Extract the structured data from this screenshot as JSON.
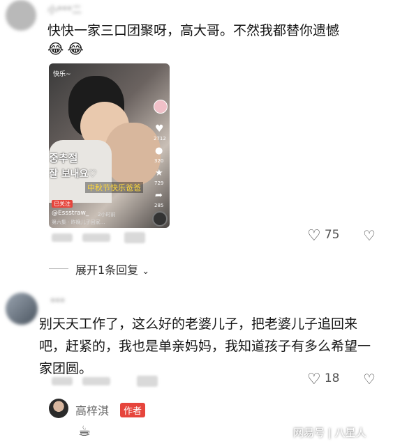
{
  "comment1": {
    "username": "小***二",
    "text": "快快一家三口团聚呀，高大哥。不然我都替你遗憾",
    "emojis": [
      "😂",
      "😂"
    ],
    "video": {
      "top_text": "快乐~",
      "subtitle_1": "중추절",
      "subtitle_2": "잘 보내요♡",
      "caption": "中秋节快乐爸爸",
      "author": "@Essstraw_",
      "time": "2小时前",
      "bottom_text": "第六集 · 昨晚儿子回家…",
      "likes": "2712",
      "comments": "320",
      "stars": "729",
      "shares": "285",
      "tag": "已关注"
    },
    "like_count": "75"
  },
  "expand_replies": "展开1条回复",
  "comment2": {
    "username": "***",
    "text": "别天天工作了，这么好的老婆儿子，把老婆儿子追回来吧，赶紧的，我也是单亲妈妈，我知道孩子有多么希望一家团圆。",
    "like_count": "18"
  },
  "reply": {
    "username": "高梓淇",
    "badge": "作者",
    "emoji": "☕"
  },
  "watermark": {
    "source": "网易号",
    "author": "八星人"
  },
  "colors": {
    "accent_red": "#e6453c",
    "text_dark": "#161616",
    "text_muted": "#666666"
  }
}
